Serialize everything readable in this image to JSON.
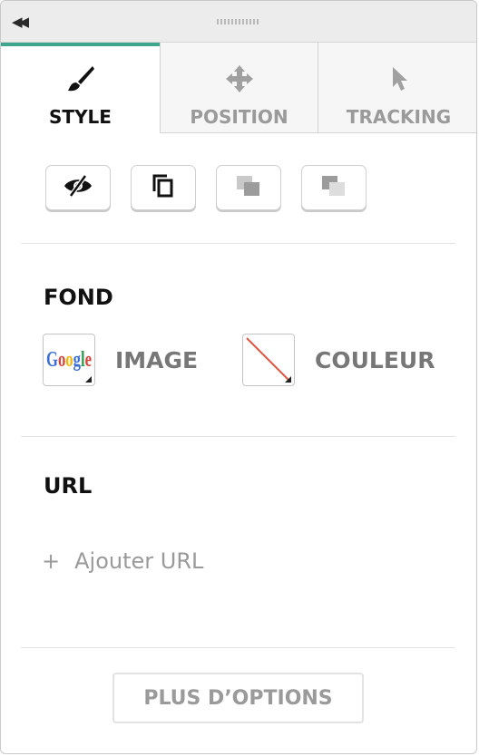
{
  "titlebar": {
    "collapse_glyph": "◀◀"
  },
  "tabs": [
    {
      "label": "STYLE",
      "icon": "brush-icon",
      "active": true
    },
    {
      "label": "POSITION",
      "icon": "move-icon",
      "active": false
    },
    {
      "label": "TRACKING",
      "icon": "cursor-icon",
      "active": false
    }
  ],
  "toolbar": {
    "buttons": [
      {
        "icon": "hide-icon"
      },
      {
        "icon": "duplicate-icon"
      },
      {
        "icon": "bring-to-front-icon"
      },
      {
        "icon": "send-to-back-icon"
      }
    ]
  },
  "fond": {
    "title": "FOND",
    "image_label": "IMAGE",
    "color_label": "COULEUR",
    "image_icon": "google-image-icon",
    "color_icon": "no-color-icon"
  },
  "url": {
    "title": "URL",
    "add_plus": "+",
    "add_label": "Ajouter URL"
  },
  "footer": {
    "more_label": "PLUS D’OPTIONS"
  },
  "colors": {
    "accent": "#3fa58c",
    "muted": "#9a9a9a",
    "no_color_line": "#e0543f"
  }
}
